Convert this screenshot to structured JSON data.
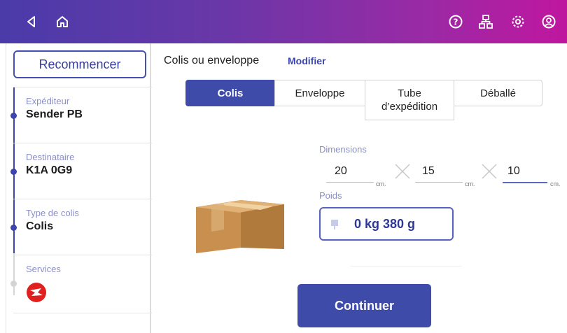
{
  "sidebar": {
    "restart_label": "Recommencer",
    "steps": [
      {
        "label": "Expéditeur",
        "value": "Sender PB"
      },
      {
        "label": "Destinataire",
        "value": "K1A 0G9"
      },
      {
        "label": "Type de colis",
        "value": "Colis"
      },
      {
        "label": "Services",
        "value": ""
      }
    ]
  },
  "main": {
    "section_title": "Colis ou enveloppe",
    "modify_label": "Modifier",
    "segments": [
      "Colis",
      "Enveloppe",
      "Tube d’expédition",
      "Déballé"
    ],
    "selected_segment": "Colis",
    "dimensions_label": "Dimensions",
    "dimensions": [
      {
        "value": "20",
        "unit": "cm."
      },
      {
        "value": "15",
        "unit": "cm."
      },
      {
        "value": "10",
        "unit": "cm."
      }
    ],
    "weight_label": "Poids",
    "weight_value": "0 kg 380 g",
    "continue_label": "Continuer"
  },
  "icons": {
    "topbar_left": [
      "back-icon",
      "home-icon"
    ],
    "topbar_right": [
      "help-icon",
      "network-icon",
      "settings-icon",
      "account-icon"
    ]
  },
  "colors": {
    "accent": "#3f4ba8",
    "topbar_start": "#4a3ba9",
    "topbar_end": "#c0169f",
    "carrier_logo": "#e0201f"
  }
}
